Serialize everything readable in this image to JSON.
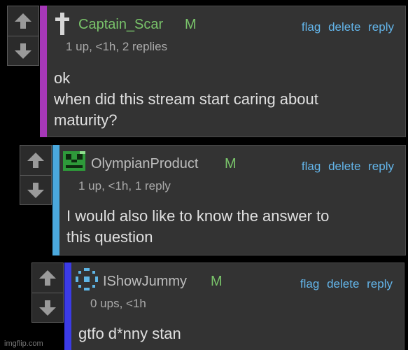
{
  "colors": {
    "accent_1": "#a638b8",
    "accent_2": "#4aa8dd",
    "accent_3": "#3b3be6",
    "username_1": "#79c36a",
    "username_2": "#bdbdbd",
    "username_3": "#bdbdbd",
    "badge": "#79c36a",
    "action_link": "#63b5ea"
  },
  "comments": [
    {
      "avatar_icon": "cross-icon",
      "username": "Captain_Scar",
      "badge": "M",
      "actions": [
        "flag",
        "delete",
        "reply"
      ],
      "meta": "1 up, <1h, 2 replies",
      "body_lines": [
        "ok",
        "when did this stream start caring about",
        "maturity?"
      ]
    },
    {
      "avatar_icon": "pixel-face-icon",
      "username": "OlympianProduct",
      "badge": "M",
      "actions": [
        "flag",
        "delete",
        "reply"
      ],
      "meta": "1 up, <1h, 1 reply",
      "body_lines": [
        "I would also like to know the answer to",
        "this question"
      ]
    },
    {
      "avatar_icon": "pixel-ring-icon",
      "username": "IShowJummy",
      "badge": "M",
      "actions": [
        "flag",
        "delete",
        "reply"
      ],
      "meta": "0 ups, <1h",
      "body_lines": [
        "gtfo d*nny stan"
      ]
    }
  ],
  "watermark": "imgflip.com"
}
